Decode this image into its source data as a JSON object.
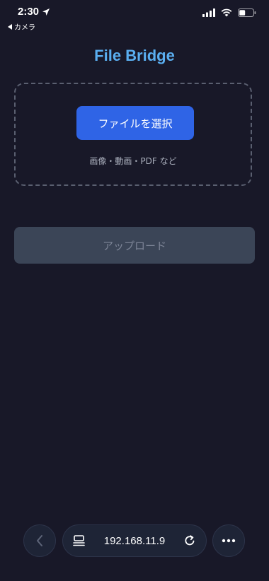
{
  "status_bar": {
    "time": "2:30",
    "back_app": "カメラ",
    "icons": [
      "location-arrow-icon",
      "signal-icon",
      "wifi-icon",
      "battery-icon"
    ]
  },
  "app": {
    "title": "File Bridge",
    "title_color": "#5aaef0"
  },
  "dropzone": {
    "select_button_label": "ファイルを選択",
    "hint": "画像・動画・PDF など"
  },
  "upload": {
    "label": "アップロード",
    "enabled": false
  },
  "browser": {
    "url": "192.168.11.9",
    "icons": [
      "back-chevron-icon",
      "tabs-icon",
      "reload-icon",
      "more-icon"
    ]
  },
  "colors": {
    "background": "#181828",
    "primary": "#2f64e6",
    "disabled": "#3b4557"
  }
}
